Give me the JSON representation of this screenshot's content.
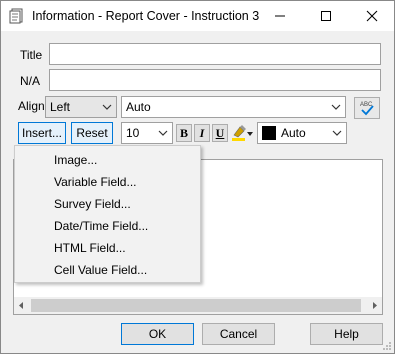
{
  "window": {
    "title": "Information - Report Cover - Instruction 3",
    "icon": "document-icon",
    "controls": [
      "minimize-icon",
      "maximize-icon",
      "close-icon"
    ]
  },
  "fields": {
    "title_label": "Title",
    "title_value": "",
    "na_label": "N/A",
    "na_value": "",
    "align_label": "Align"
  },
  "toolbar": {
    "align_value": "Left",
    "font_value": "Auto",
    "insert_label": "Insert...",
    "reset_label": "Reset",
    "size_value": "10",
    "bold_label": "B",
    "italic_label": "I",
    "underline_label": "U",
    "color_value": "Auto",
    "color_swatch": "#000000",
    "highlight_icon": "highlighter-icon",
    "spellcheck_icon": "spellcheck-icon"
  },
  "insert_menu": {
    "items": [
      "Image...",
      "Variable Field...",
      "Survey Field...",
      "Date/Time Field...",
      "HTML Field...",
      "Cell Value Field..."
    ]
  },
  "footer": {
    "ok_label": "OK",
    "cancel_label": "Cancel",
    "help_label": "Help"
  },
  "colors": {
    "accent": "#0078d7",
    "window_bg": "#f0f0f0"
  }
}
